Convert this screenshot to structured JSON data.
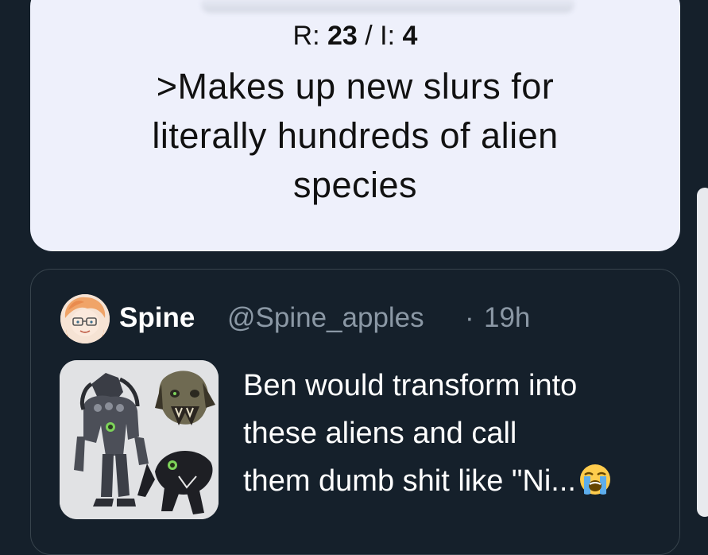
{
  "meme": {
    "stats_r_label": "R: ",
    "stats_r_value": "23",
    "stats_sep": " / I: ",
    "stats_i_value": "4",
    "lines": [
      ">Makes up new slurs for",
      "literally hundreds of alien",
      "species"
    ]
  },
  "quoted_tweet": {
    "author_name": "Spine",
    "author_handle": "@Spine_apples",
    "separator": "·",
    "timestamp": "19h",
    "text_lines": [
      "Ben would transform into",
      "these aliens and call",
      "them dumb shit like \"Ni..."
    ],
    "emoji": "loudly-crying-face-emoji",
    "media": "alien-characters-artwork-image",
    "avatar": "user-avatar-illustration"
  },
  "colors": {
    "background": "#15202b",
    "meme_card": "#eef0fb",
    "border": "#38444d",
    "secondary_text": "#8b98a5",
    "primary_text": "#ffffff"
  }
}
